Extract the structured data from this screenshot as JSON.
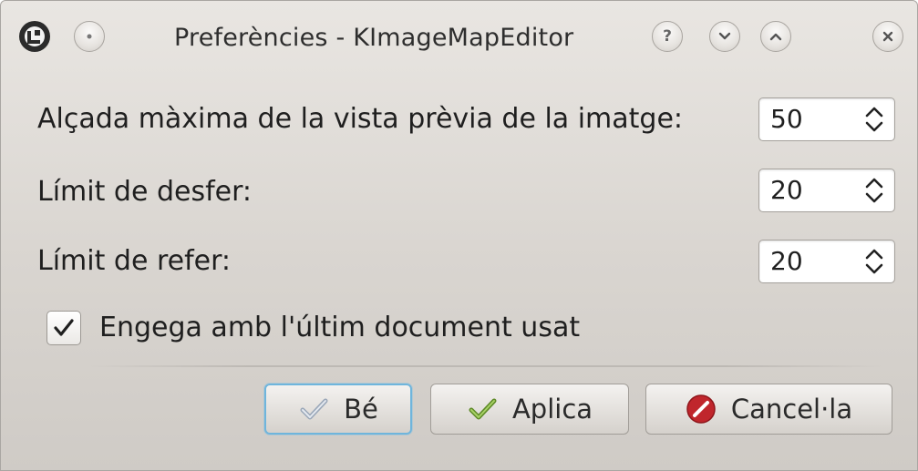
{
  "window": {
    "title": "Preferències - KImageMapEditor",
    "titlebar_buttons": {
      "menu_icon": "window-menu-icon",
      "pin_icon": "pin-dot-icon",
      "help_label": "?",
      "minimize_icon": "chevron-down-icon",
      "maximize_icon": "chevron-up-icon",
      "close_icon": "close-icon"
    }
  },
  "settings": {
    "max_preview_height": {
      "label": "Alçada màxima de la vista prèvia de la imatge:",
      "value": "50"
    },
    "undo_limit": {
      "label": "Límit de desfer:",
      "value": "20"
    },
    "redo_limit": {
      "label": "Límit de refer:",
      "value": "20"
    },
    "start_with_last_document": {
      "label": "Engega amb l'últim document usat",
      "checked": true
    }
  },
  "buttons": {
    "ok": {
      "label": "Bé",
      "icon": "check-icon"
    },
    "apply": {
      "label": "Aplica",
      "icon": "check-green-icon"
    },
    "cancel": {
      "label": "Cancel·la",
      "icon": "cancel-icon"
    }
  },
  "colors": {
    "default_button_border": "#6fb5dc",
    "cancel_icon": "#c0262c",
    "apply_check": "#7aa83a"
  }
}
